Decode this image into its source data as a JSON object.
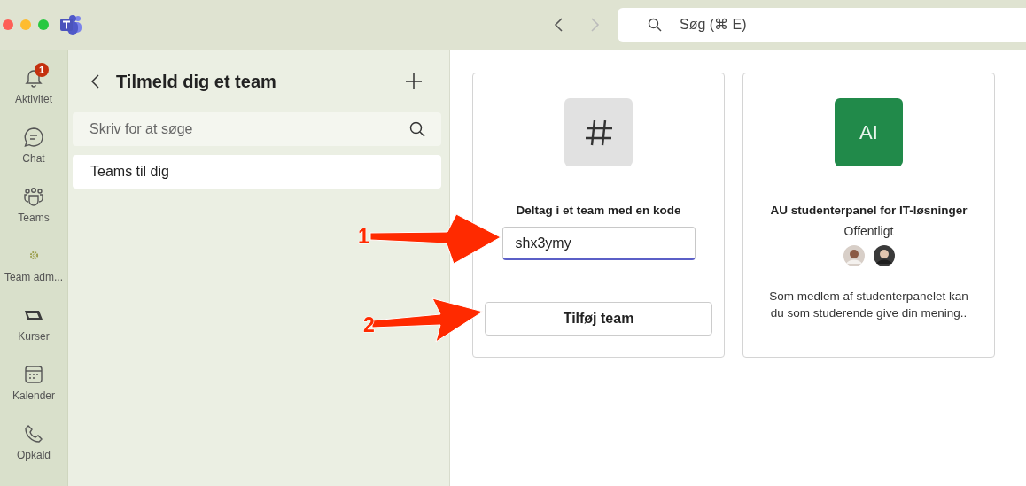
{
  "titlebar": {
    "search": {
      "placeholder": "Søg (⌘ E)"
    }
  },
  "rail": {
    "items": [
      {
        "label": "Aktivitet",
        "badge": "1"
      },
      {
        "label": "Chat"
      },
      {
        "label": "Teams"
      },
      {
        "label": "Team adm..."
      },
      {
        "label": "Kurser"
      },
      {
        "label": "Kalender"
      },
      {
        "label": "Opkald"
      }
    ]
  },
  "panel": {
    "title": "Tilmeld dig et team",
    "search": {
      "placeholder": "Skriv for at søge"
    },
    "items": [
      {
        "label": "Teams til dig",
        "selected": true
      }
    ]
  },
  "cards": [
    {
      "kind": "code",
      "heading": "Deltag i et team med en kode",
      "field": {
        "value": "shx3ymy",
        "focused": true
      },
      "button": "Tilføj team"
    },
    {
      "kind": "team",
      "avatar": "AI",
      "color": "#218a4a",
      "title": "AU studenterpanel for IT-løsninger",
      "visibility": "Offentligt",
      "description": "Som medlem af studenterpanelet kan du som studerende give din mening.."
    }
  ],
  "annotations": [
    {
      "label": "1"
    },
    {
      "label": "2"
    }
  ]
}
